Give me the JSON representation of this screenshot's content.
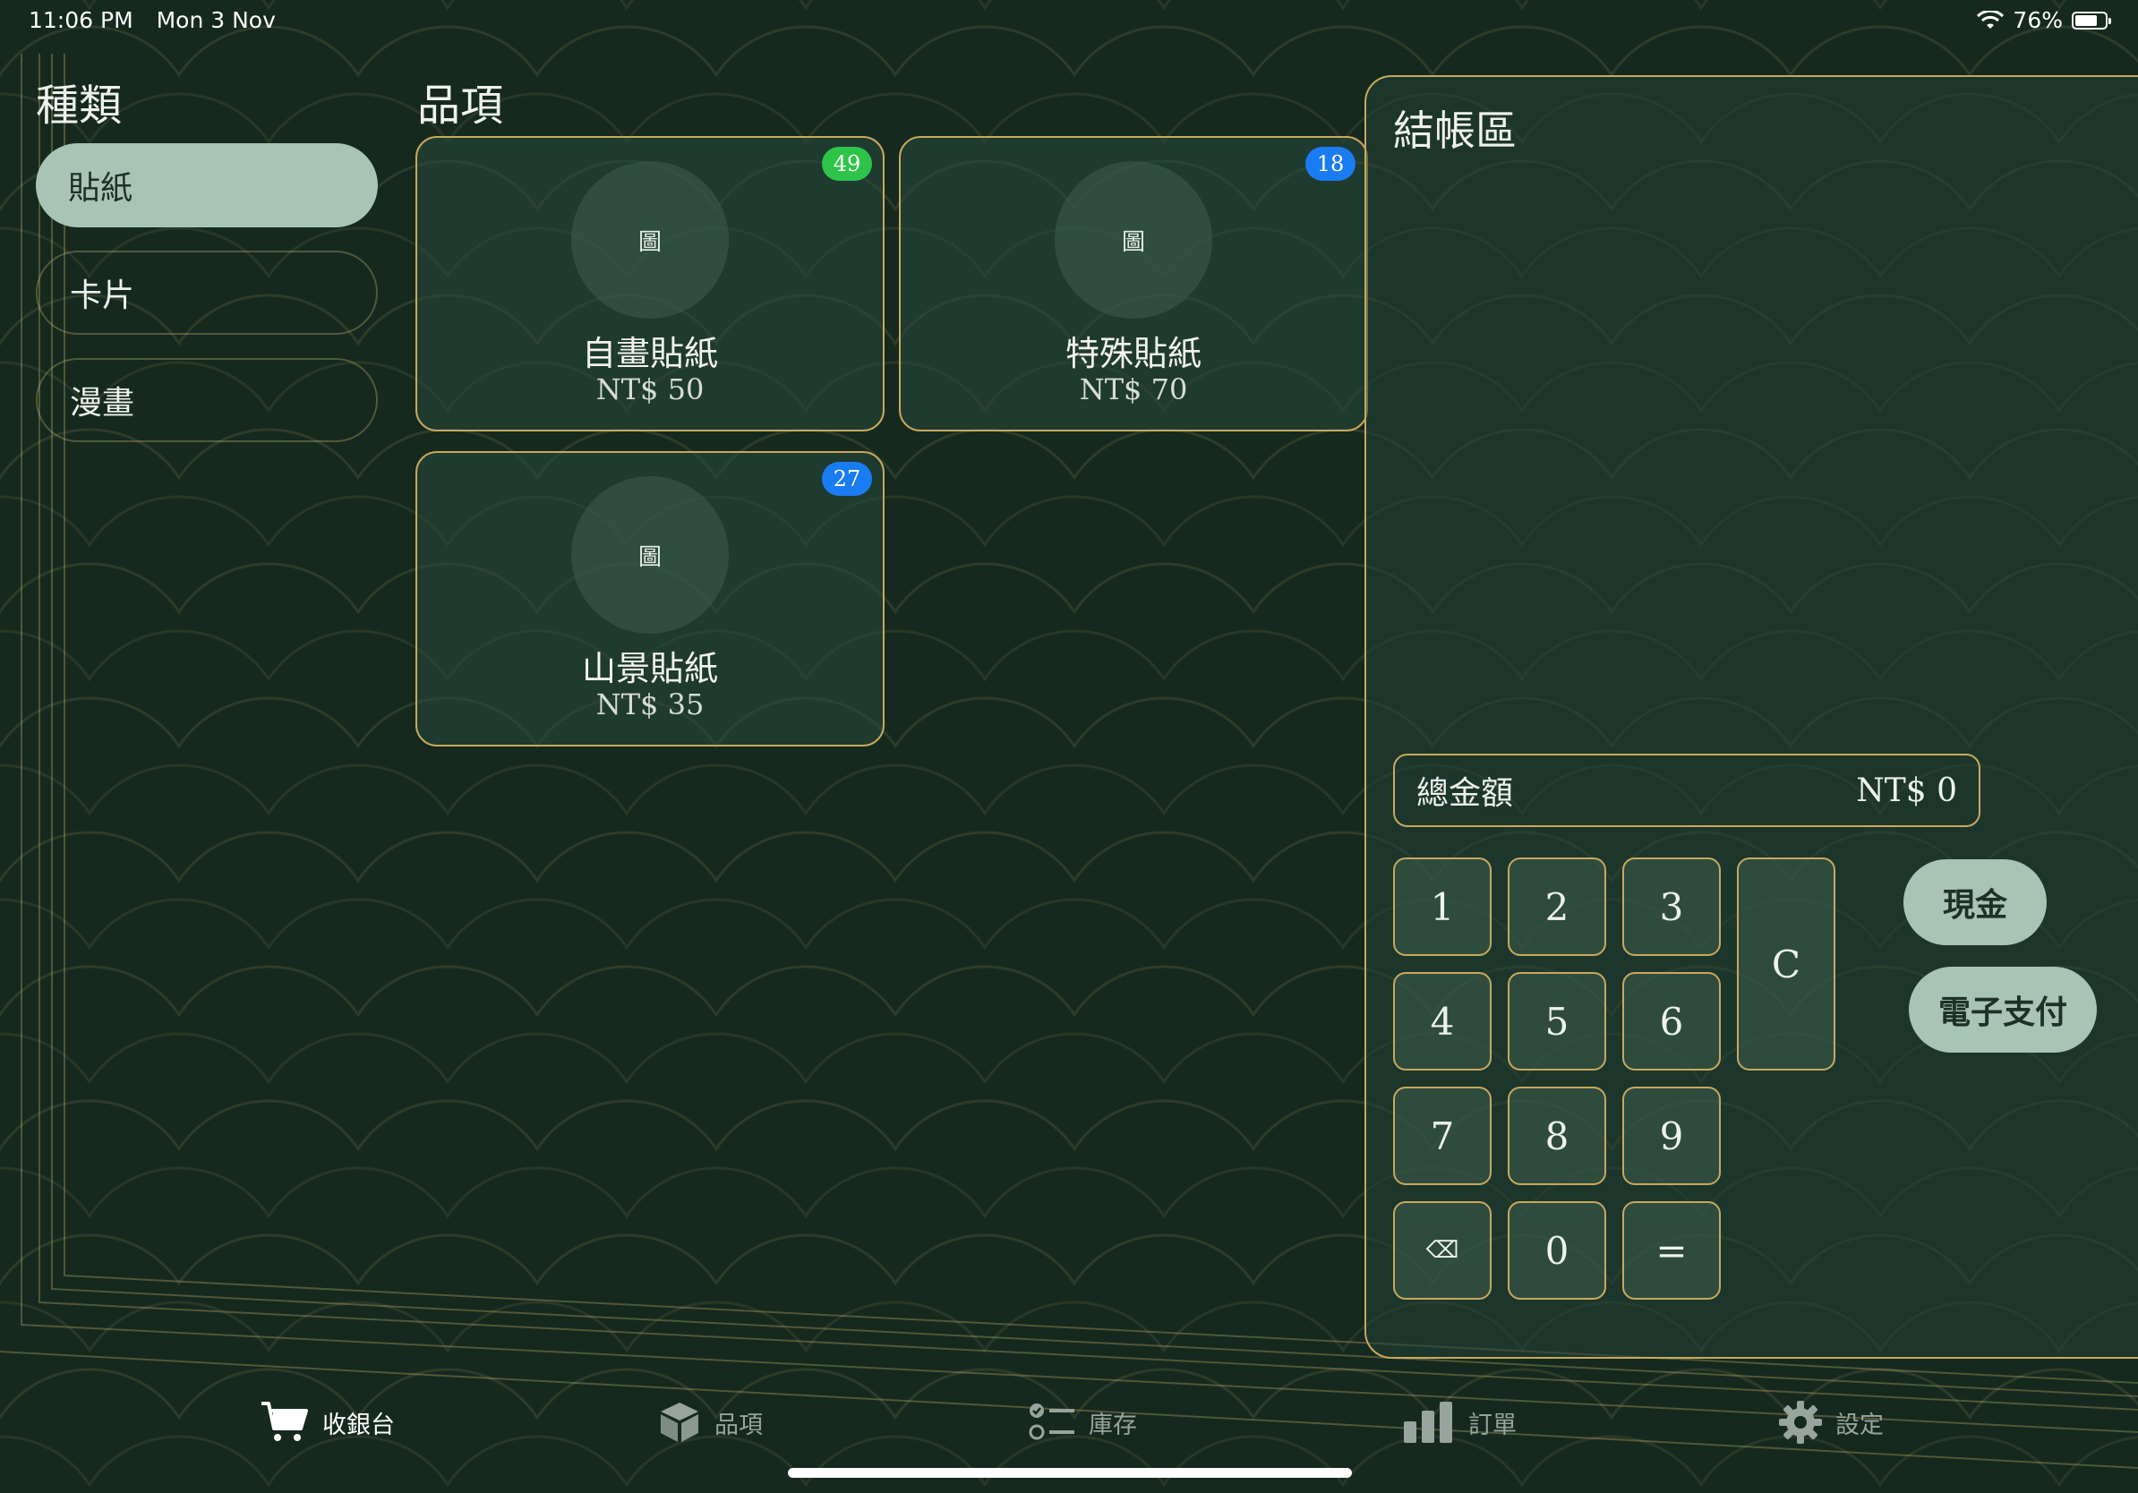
{
  "status": {
    "time": "11:06 PM",
    "date": "Mon 3 Nov",
    "battery": "76%",
    "battery_level": 0.76
  },
  "categories": {
    "title": "種類",
    "items": [
      {
        "label": "貼紙",
        "active": true
      },
      {
        "label": "卡片",
        "active": false
      },
      {
        "label": "漫畫",
        "active": false
      }
    ]
  },
  "items": {
    "title": "品項",
    "cards": [
      {
        "image": "圖",
        "name": "自畫貼紙",
        "price": "NT$ 50",
        "badge": "49",
        "badge_color": "#2ec44a"
      },
      {
        "image": "圖",
        "name": "特殊貼紙",
        "price": "NT$ 70",
        "badge": "18",
        "badge_color": "#1a7cf2"
      },
      {
        "image": "圖",
        "name": "山景貼紙",
        "price": "NT$ 35",
        "badge": "27",
        "badge_color": "#1a7cf2"
      }
    ]
  },
  "checkout": {
    "title": "結帳區",
    "total_label": "總金額",
    "total_value": "NT$ 0",
    "keys": [
      "1",
      "2",
      "3",
      "4",
      "5",
      "6",
      "7",
      "8",
      "9",
      "⌫",
      "0",
      "="
    ],
    "clear": "C",
    "cash": "現金",
    "epay": "電子支付"
  },
  "tabs": [
    {
      "label": "收銀台",
      "icon": "cart-icon",
      "active": true
    },
    {
      "label": "品項",
      "icon": "box-icon",
      "active": false
    },
    {
      "label": "庫存",
      "icon": "checklist-icon",
      "active": false
    },
    {
      "label": "訂單",
      "icon": "bar-chart-icon",
      "active": false
    },
    {
      "label": "設定",
      "icon": "gear-icon",
      "active": false
    }
  ],
  "colors": {
    "accent_border": "#c8a95c",
    "pill": "#a8c4b4",
    "background": "#13281f"
  }
}
